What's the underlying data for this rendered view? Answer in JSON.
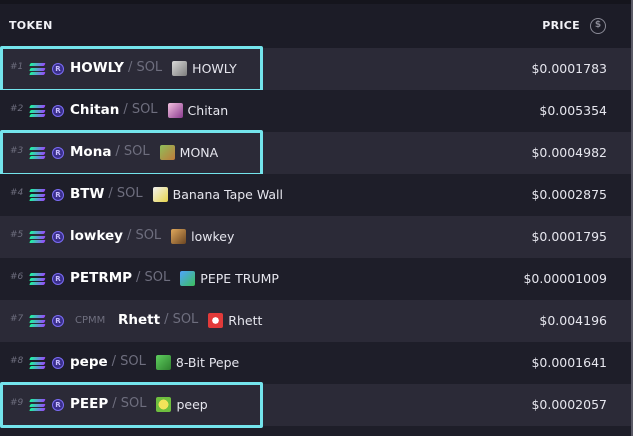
{
  "header": {
    "token_label": "TOKEN",
    "price_label": "PRICE",
    "currency_icon": "dollar-circle-icon"
  },
  "colors": {
    "highlight": "#74e4ec",
    "row_alt": "#2b2a37",
    "row_base": "#1e1e29",
    "muted": "#6e6e7e"
  },
  "rows": [
    {
      "rank": "#1",
      "pool": "",
      "symbol": "HOWLY",
      "quote": "/ SOL",
      "name": "HOWLY",
      "price": "$0.0001783",
      "img": "wolf-avatar",
      "highlighted": true
    },
    {
      "rank": "#2",
      "pool": "",
      "symbol": "Chitan",
      "quote": "/ SOL",
      "name": "Chitan",
      "price": "$0.005354",
      "img": "chitan-avatar",
      "highlighted": false
    },
    {
      "rank": "#3",
      "pool": "",
      "symbol": "Mona",
      "quote": "/ SOL",
      "name": "MONA",
      "price": "$0.0004982",
      "img": "mona-avatar",
      "highlighted": true
    },
    {
      "rank": "#4",
      "pool": "",
      "symbol": "BTW",
      "quote": "/ SOL",
      "name": "Banana Tape Wall",
      "price": "$0.0002875",
      "img": "banana-avatar",
      "highlighted": false
    },
    {
      "rank": "#5",
      "pool": "",
      "symbol": "lowkey",
      "quote": "/ SOL",
      "name": "lowkey",
      "price": "$0.0001795",
      "img": "dog-avatar",
      "highlighted": false
    },
    {
      "rank": "#6",
      "pool": "",
      "symbol": "PETRMP",
      "quote": "/ SOL",
      "name": "PEPE TRUMP",
      "price": "$0.00001009",
      "img": "pepe-trump-avatar",
      "highlighted": false
    },
    {
      "rank": "#7",
      "pool": "CPMM",
      "symbol": "Rhett",
      "quote": "/ SOL",
      "name": "Rhett",
      "price": "$0.004196",
      "img": "rhett-avatar",
      "highlighted": false
    },
    {
      "rank": "#8",
      "pool": "",
      "symbol": "pepe",
      "quote": "/ SOL",
      "name": "8-Bit Pepe",
      "price": "$0.0001641",
      "img": "pixel-pepe-avatar",
      "highlighted": false
    },
    {
      "rank": "#9",
      "pool": "",
      "symbol": "PEEP",
      "quote": "/ SOL",
      "name": "peep",
      "price": "$0.0002057",
      "img": "peep-avatar",
      "highlighted": true
    }
  ]
}
